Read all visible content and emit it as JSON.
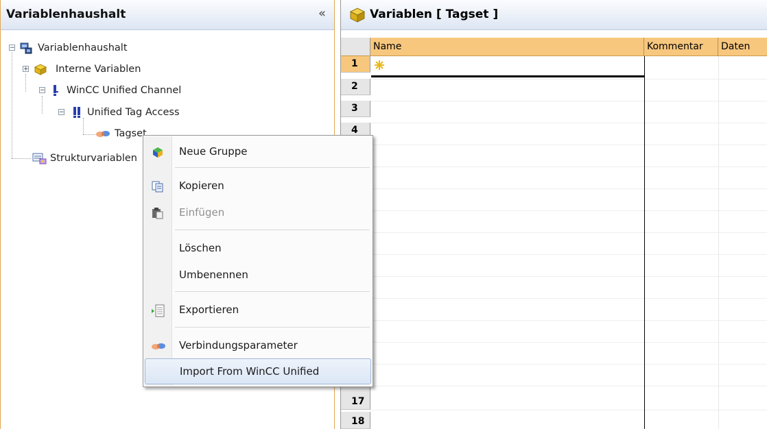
{
  "left_panel": {
    "title": "Variablenhaushalt",
    "collapse_glyph": "«",
    "tree": [
      {
        "label": "Variablenhaushalt",
        "icon": "tag-management-icon",
        "expander": "−"
      },
      {
        "label": "Interne Variablen",
        "icon": "internal-tags-icon",
        "expander": "+"
      },
      {
        "label": "WinCC Unified Channel",
        "icon": "channel-icon",
        "expander": "−"
      },
      {
        "label": "Unified Tag Access",
        "icon": "connection-icon",
        "expander": "−"
      },
      {
        "label": "Tagset",
        "icon": "tagset-handshake-icon"
      },
      {
        "label": "Strukturvariablen",
        "icon": "structure-tags-icon"
      }
    ]
  },
  "right_panel": {
    "title": "Variablen [ Tagset ]",
    "columns": [
      "Name",
      "Kommentar",
      "Daten"
    ],
    "row_numbers": [
      "1",
      "2",
      "3",
      "4",
      "17",
      "18"
    ]
  },
  "context_menu": {
    "items": [
      {
        "label": "Neue Gruppe",
        "icon": "new-group-icon",
        "enabled": true
      },
      {
        "label": "Kopieren",
        "icon": "copy-icon",
        "enabled": true
      },
      {
        "label": "Einfügen",
        "icon": "paste-icon",
        "enabled": false
      },
      {
        "label": "Löschen",
        "icon": "",
        "enabled": true
      },
      {
        "label": "Umbenennen",
        "icon": "",
        "enabled": true
      },
      {
        "label": "Exportieren",
        "icon": "export-icon",
        "enabled": true
      },
      {
        "label": "Verbindungsparameter",
        "icon": "connection-parameters-icon",
        "enabled": true
      },
      {
        "label": "Import From WinCC Unified",
        "icon": "",
        "enabled": true,
        "highlighted": true
      }
    ]
  },
  "colors": {
    "accent_border": "#e3a650",
    "grid_header": "#f7c77e",
    "menu_highlight": "#dbe6f5"
  }
}
